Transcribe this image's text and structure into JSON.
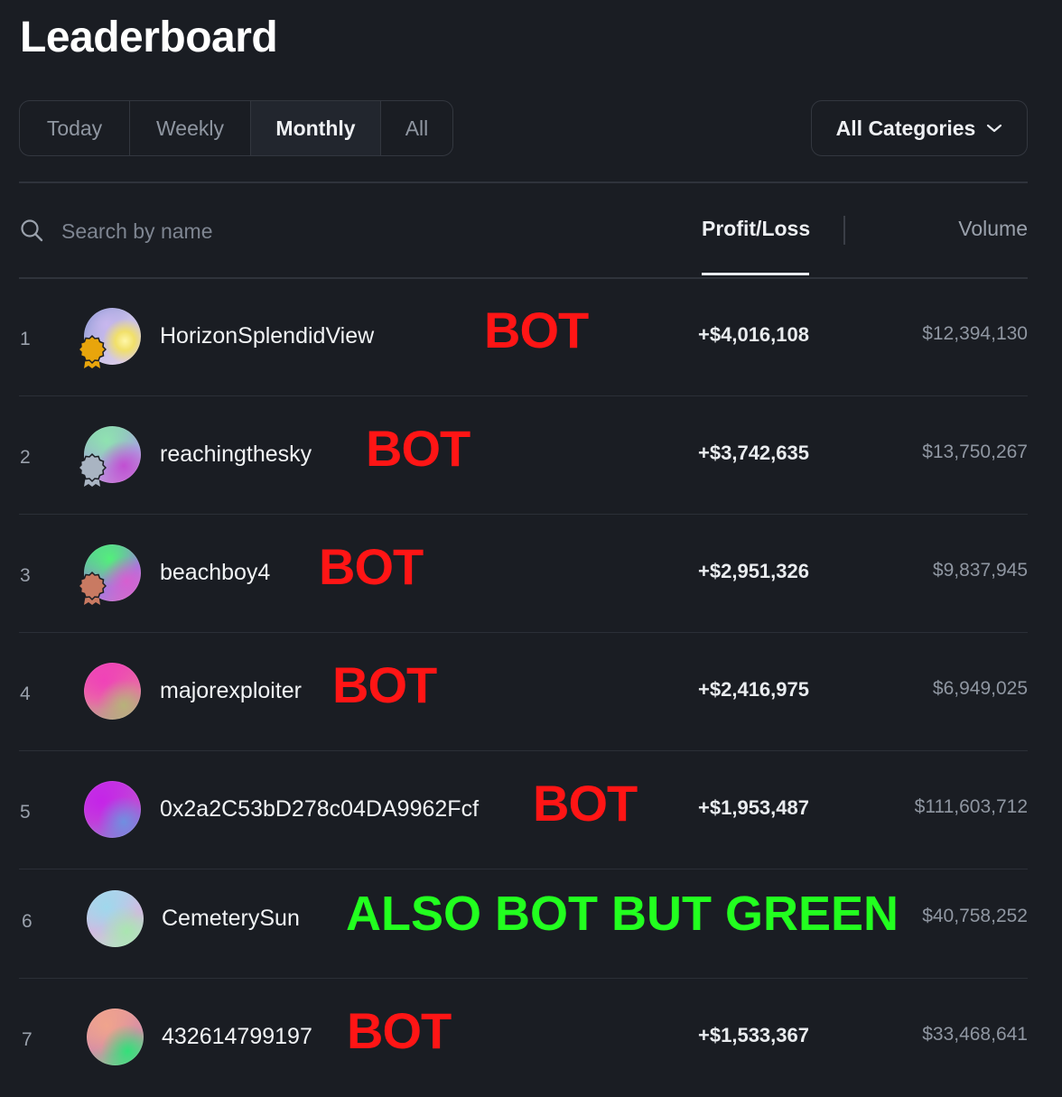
{
  "page": {
    "title": "Leaderboard"
  },
  "tabs": [
    {
      "label": "Today"
    },
    {
      "label": "Weekly"
    },
    {
      "label": "Monthly",
      "active": true
    },
    {
      "label": "All"
    }
  ],
  "category": {
    "label": "All Categories",
    "icon": "chevron-down-icon"
  },
  "search": {
    "placeholder": "Search by name",
    "value": "",
    "icon": "search-icon"
  },
  "columns": {
    "profit_loss": "Profit/Loss",
    "volume": "Volume",
    "sorted_by": "Profit/Loss"
  },
  "rows": [
    {
      "rank": "1",
      "name": "HorizonSplendidView",
      "annotation": "BOT",
      "annotation_color": "#ff1515",
      "profit_loss": "+$4,016,108",
      "volume": "$12,394,130",
      "medal": "gold"
    },
    {
      "rank": "2",
      "name": "reachingthesky",
      "annotation": "BOT",
      "annotation_color": "#ff1515",
      "profit_loss": "+$3,742,635",
      "volume": "$13,750,267",
      "medal": "silver"
    },
    {
      "rank": "3",
      "name": "beachboy4",
      "annotation": "BOT",
      "annotation_color": "#ff1515",
      "profit_loss": "+$2,951,326",
      "volume": "$9,837,945",
      "medal": "bronze"
    },
    {
      "rank": "4",
      "name": "majorexploiter",
      "annotation": "BOT",
      "annotation_color": "#ff1515",
      "profit_loss": "+$2,416,975",
      "volume": "$6,949,025",
      "medal": null
    },
    {
      "rank": "5",
      "name": "0x2a2C53bD278c04DA9962Fcf",
      "annotation": "BOT",
      "annotation_color": "#ff1515",
      "profit_loss": "+$1,953,487",
      "volume": "$111,603,712",
      "medal": null
    },
    {
      "rank": "6",
      "name": "CemeterySun",
      "annotation": "ALSO BOT BUT GREEN",
      "annotation_color": "#22ff1f",
      "profit_loss": "",
      "volume": "$40,758,252",
      "medal": null
    },
    {
      "rank": "7",
      "name": "432614799197",
      "annotation": "BOT",
      "annotation_color": "#ff1515",
      "profit_loss": "+$1,533,367",
      "volume": "$33,468,641",
      "medal": null
    }
  ],
  "colors": {
    "background": "#1a1d23",
    "bot_red": "#ff1515",
    "bot_green": "#22ff1f",
    "medal_gold": "#e8a50c",
    "medal_silver": "#a9b4c2",
    "medal_bronze": "#c97a62"
  }
}
